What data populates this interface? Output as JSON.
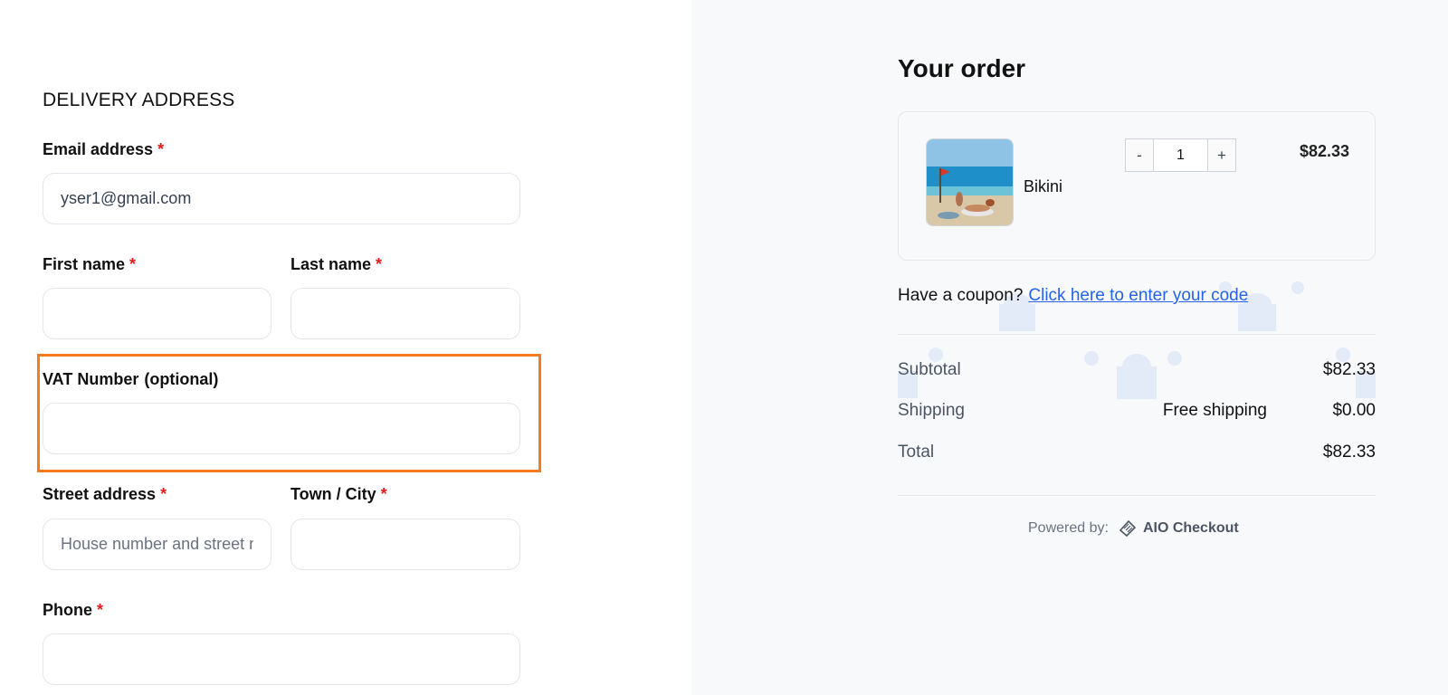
{
  "delivery": {
    "section_title": "DELIVERY ADDRESS",
    "email": {
      "label": "Email address",
      "required": "*",
      "value": "yser1@gmail.com"
    },
    "first_name": {
      "label": "First name",
      "required": "*",
      "value": ""
    },
    "last_name": {
      "label": "Last name",
      "required": "*",
      "value": ""
    },
    "vat": {
      "label": "VAT Number",
      "optional": "(optional)",
      "value": ""
    },
    "street": {
      "label": "Street address",
      "required": "*",
      "placeholder": "House number and street name"
    },
    "city": {
      "label": "Town / City",
      "required": "*",
      "value": ""
    },
    "phone": {
      "label": "Phone",
      "required": "*",
      "value": ""
    }
  },
  "order": {
    "title": "Your order",
    "product": {
      "name": "Bikini",
      "price": "$82.33",
      "quantity": "1",
      "minus": "-",
      "plus": "+"
    },
    "coupon": {
      "text": "Have a coupon?",
      "link": "Click here to enter your code"
    },
    "subtotal": {
      "label": "Subtotal",
      "value": "$82.33"
    },
    "shipping": {
      "label": "Shipping",
      "method": "Free shipping",
      "value": "$0.00"
    },
    "total": {
      "label": "Total",
      "value": "$82.33"
    },
    "powered": {
      "label": "Powered by:",
      "brand": "AIO Checkout"
    }
  },
  "colors": {
    "accent_link": "#2563eb",
    "highlight": "#f47b20",
    "required": "#e11d1d",
    "panel_bg": "#f8f9fb"
  },
  "icons": {
    "brand": "aio-checkout-logo-icon",
    "background": "shopping-bag-icon"
  }
}
